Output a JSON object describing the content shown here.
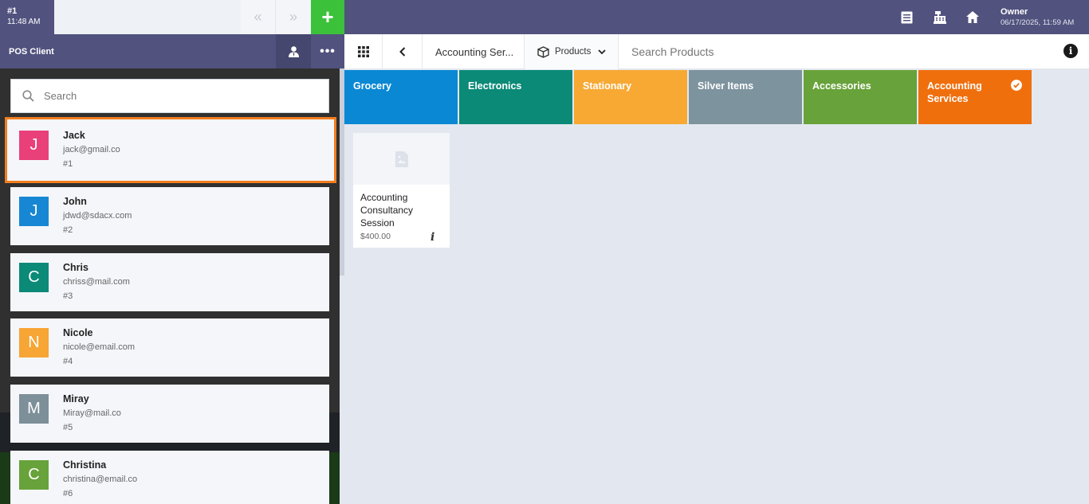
{
  "order": {
    "number": "#1",
    "time": "11:48 AM"
  },
  "user": {
    "name": "Owner",
    "datetime": "06/17/2025, 11:59 AM"
  },
  "icons": {
    "prev": "double-chevron-left-icon",
    "next": "double-chevron-right-icon",
    "add": "plus-icon",
    "receipt": "receipt-icon",
    "register": "cash-register-icon",
    "home": "home-icon"
  },
  "client_panel": {
    "title": "POS Client",
    "search_placeholder": "Search",
    "clients": [
      {
        "initial": "J",
        "name": "Jack",
        "email": "jack@gmail.co",
        "id": "#1",
        "color": "#e9407a",
        "selected": true
      },
      {
        "initial": "J",
        "name": "John",
        "email": "jdwd@sdacx.com",
        "id": "#2",
        "color": "#1787d4"
      },
      {
        "initial": "C",
        "name": "Chris",
        "email": "chriss@mail.com",
        "id": "#3",
        "color": "#0b8a78"
      },
      {
        "initial": "N",
        "name": "Nicole",
        "email": "nicole@email.com",
        "id": "#4",
        "color": "#f7a534"
      },
      {
        "initial": "M",
        "name": "Miray",
        "email": "Miray@mail.co",
        "id": "#5",
        "color": "#7d8f99"
      },
      {
        "initial": "C",
        "name": "Christina",
        "email": "christina@email.co",
        "id": "#6",
        "color": "#68a23a"
      }
    ]
  },
  "toolbar": {
    "breadcrumb": "Accounting Ser...",
    "products_label": "Products",
    "search_placeholder": "Search Products"
  },
  "categories": [
    {
      "label": "Grocery",
      "color": "#0a88d4"
    },
    {
      "label": "Electronics",
      "color": "#0b8a78"
    },
    {
      "label": "Stationary",
      "color": "#f7a934"
    },
    {
      "label": "Silver Items",
      "color": "#7d939e"
    },
    {
      "label": "Accessories",
      "color": "#68a23a"
    },
    {
      "label": "Accounting Services",
      "color": "#f06f0d",
      "selected": true
    }
  ],
  "products": [
    {
      "name": "Accounting Consultancy Session",
      "price": "$400.00"
    }
  ]
}
